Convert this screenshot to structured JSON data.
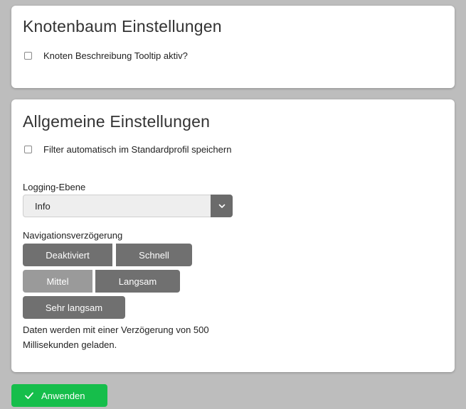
{
  "node_tree_settings": {
    "title": "Knotenbaum Einstellungen",
    "tooltip_checkbox": {
      "label": "Knoten Beschreibung Tooltip aktiv?",
      "checked": false
    }
  },
  "general_settings": {
    "title": "Allgemeine Einstellungen",
    "filter_checkbox": {
      "label": "Filter automatisch im Standardprofil speichern",
      "checked": false
    },
    "logging": {
      "label": "Logging-Ebene",
      "selected": "Info",
      "dropdown_icon": "chevron-down-icon"
    },
    "navigation_delay": {
      "label": "Navigationsverzögerung",
      "options": [
        "Deaktiviert",
        "Schnell",
        "Mittel",
        "Langsam",
        "Sehr langsam"
      ],
      "selected": "Mittel",
      "description": "Daten werden mit einer Verzögerung von 500 Millisekunden geladen."
    }
  },
  "actions": {
    "apply_label": "Anwenden",
    "apply_icon": "check-icon"
  },
  "colors": {
    "background": "#bdbdbd",
    "card": "#ffffff",
    "segment_button": "#707070",
    "segment_button_active": "#9a9a9a",
    "select_button": "#6b6b6b",
    "apply_button": "#16be4b"
  }
}
